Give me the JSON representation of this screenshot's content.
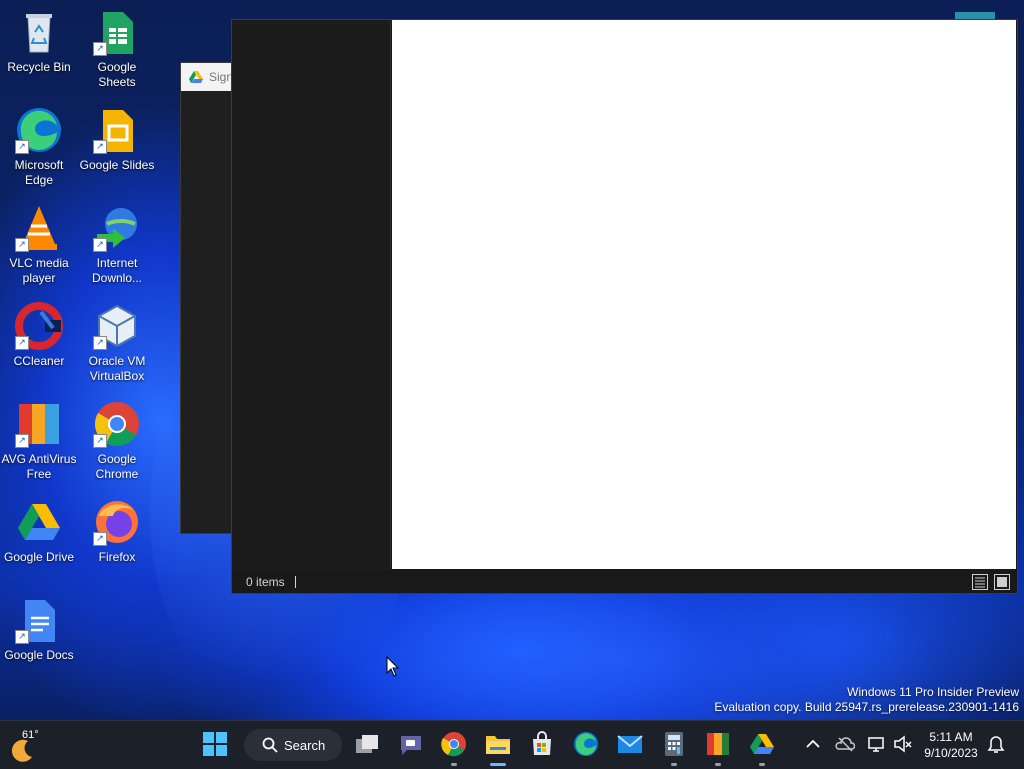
{
  "desktop": {
    "icons": [
      {
        "label": "Recycle Bin"
      },
      {
        "label": "Google Sheets"
      },
      {
        "label": "Microsoft Edge"
      },
      {
        "label": "Google Slides"
      },
      {
        "label": "VLC media player"
      },
      {
        "label": "Internet Downlo..."
      },
      {
        "label": "CCleaner"
      },
      {
        "label": "Oracle VM VirtualBox"
      },
      {
        "label": "AVG AntiVirus Free"
      },
      {
        "label": "Google Chrome"
      },
      {
        "label": "Google Drive"
      },
      {
        "label": "Firefox"
      },
      {
        "label": "Google Docs"
      }
    ]
  },
  "bg_window": {
    "title": "Sign"
  },
  "explorer": {
    "status_count": "0 items"
  },
  "watermark": {
    "line1": "Windows 11 Pro Insider Preview",
    "line2": "Evaluation copy. Build 25947.rs_prerelease.230901-1416"
  },
  "taskbar": {
    "weather_temp": "61°",
    "search_label": "Search",
    "time": "5:11 AM",
    "date": "9/10/2023",
    "pinned": [
      "start-icon",
      "task-view-icon",
      "teams-chat-icon",
      "chrome-icon",
      "file-explorer-icon",
      "microsoft-store-icon",
      "edge-icon",
      "mail-icon",
      "calculator-icon",
      "avg-icon",
      "google-drive-icon"
    ]
  },
  "colors": {
    "taskbar_bg": "#1c2029",
    "accent": "#6cb8ff"
  }
}
